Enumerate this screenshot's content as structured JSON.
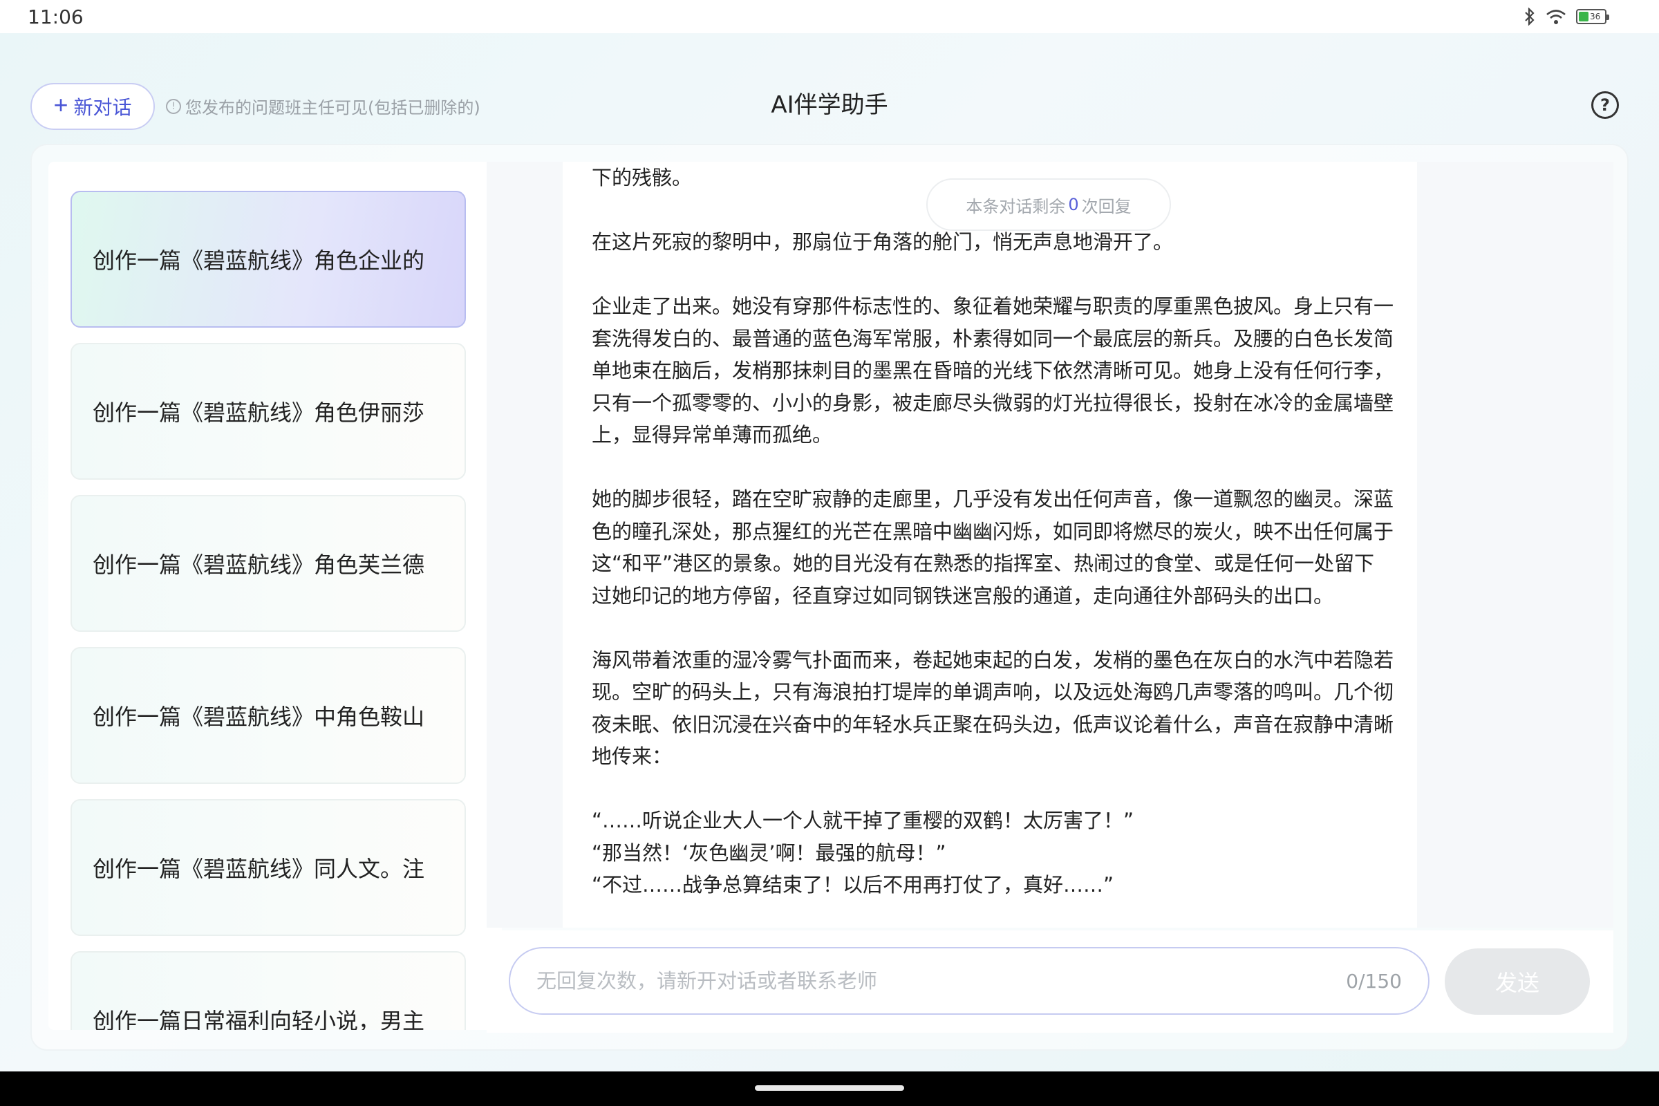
{
  "status_bar": {
    "time": "11:06",
    "icons": [
      "bluetooth-icon",
      "wifi-icon",
      "battery-icon"
    ],
    "battery_level": "36"
  },
  "header": {
    "new_chat_plus": "+",
    "new_chat_label": "新对话",
    "notice": "您发布的问题班主任可见(包括已删除的)",
    "notice_icon_glyph": "!",
    "title": "AI伴学助手",
    "help_glyph": "?"
  },
  "sidebar": {
    "items": [
      {
        "label": "创作一篇《碧蓝航线》角色企业的",
        "active": true
      },
      {
        "label": "创作一篇《碧蓝航线》角色伊丽莎",
        "active": false
      },
      {
        "label": "创作一篇《碧蓝航线》角色芙兰德",
        "active": false
      },
      {
        "label": "创作一篇《碧蓝航线》中角色鞍山",
        "active": false
      },
      {
        "label": "创作一篇《碧蓝航线》同人文。注",
        "active": false
      },
      {
        "label": "创作一篇日常福利向轻小说，男主",
        "active": false
      }
    ]
  },
  "chat": {
    "remaining_prefix": "本条对话剩余",
    "remaining_count": "0",
    "remaining_suffix": "次回复",
    "paragraphs": [
      "下的残骸。",
      "在这片死寂的黎明中，那扇位于角落的舱门，悄无声息地滑开了。",
      "企业走了出来。她没有穿那件标志性的、象征着她荣耀与职责的厚重黑色披风。身上只有一套洗得发白的、最普通的蓝色海军常服，朴素得如同一个最底层的新兵。及腰的白色长发简单地束在脑后，发梢那抹刺目的墨黑在昏暗的光线下依然清晰可见。她身上没有任何行李，只有一个孤零零的、小小的身影，被走廊尽头微弱的灯光拉得很长，投射在冰冷的金属墙壁上，显得异常单薄而孤绝。",
      "她的脚步很轻，踏在空旷寂静的走廊里，几乎没有发出任何声音，像一道飘忽的幽灵。深蓝色的瞳孔深处，那点猩红的光芒在黑暗中幽幽闪烁，如同即将燃尽的炭火，映不出任何属于这“和平”港区的景象。她的目光没有在熟悉的指挥室、热闹过的食堂、或是任何一处留下过她印记的地方停留，径直穿过如同钢铁迷宫般的通道，走向通往外部码头的出口。",
      "海风带着浓重的湿冷雾气扑面而来，卷起她束起的白发，发梢的墨色在灰白的水汽中若隐若现。空旷的码头上，只有海浪拍打堤岸的单调声响，以及远处海鸥几声零落的鸣叫。几个彻夜未眠、依旧沉浸在兴奋中的年轻水兵正聚在码头边，低声议论着什么，声音在寂静中清晰地传来："
    ],
    "quotes": [
      "“……听说企业大人一个人就干掉了重樱的双鹤！太厉害了！”",
      "“那当然！‘灰色幽灵’啊！最强的航母！”",
      "“不过……战争总算结束了！以后不用再打仗了，真好……”"
    ]
  },
  "input": {
    "placeholder": "无回复次数，请新开对话或者联系老师",
    "value": "",
    "char_count": "0/150",
    "send_label": "发送"
  }
}
